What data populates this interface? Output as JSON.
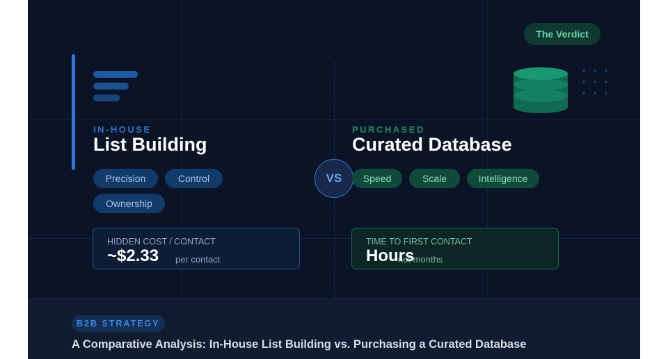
{
  "left": {
    "eyebrow": "IN-HOUSE",
    "title": "List Building",
    "tags": [
      "Precision",
      "Control",
      "Ownership"
    ],
    "stat_label": "HIDDEN COST / CONTACT",
    "stat_value": "~$2.33",
    "stat_sub": "per contact"
  },
  "right": {
    "eyebrow": "PURCHASED",
    "title": "Curated Database",
    "tags": [
      "Speed",
      "Scale",
      "Intelligence"
    ],
    "stat_label": "TIME TO FIRST CONTACT",
    "stat_value": "Hours",
    "stat_sub": "not months"
  },
  "vs_label": "VS",
  "verdict_label": "The Verdict",
  "footer": {
    "tag": "B2B STRATEGY",
    "title": "A Comparative Analysis: In-House List Building vs. Purchasing a Curated Database"
  },
  "colors": {
    "background": "#0b1426",
    "blue_accent": "#2f7ad8",
    "green_accent": "#1f8a63"
  },
  "icons": [
    "list-lines-icon",
    "database-icon",
    "dot-grid-icon"
  ]
}
